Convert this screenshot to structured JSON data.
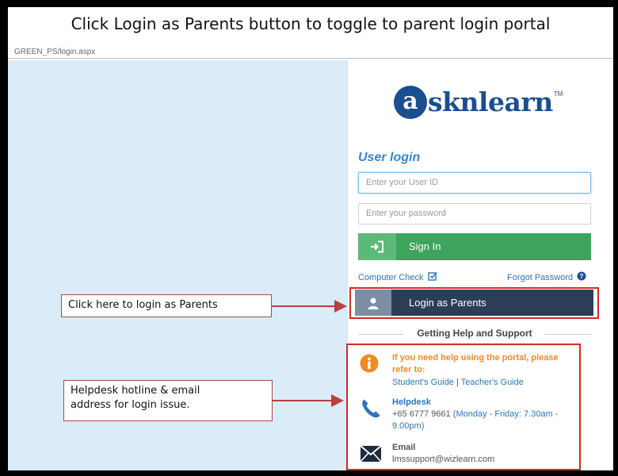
{
  "slide": {
    "title": "Click Login as Parents button to toggle to parent login portal"
  },
  "browser": {
    "url": "GREEN_PS/login.aspx"
  },
  "logo": {
    "letter": "a",
    "text": "sknlearn",
    "tm": "TM"
  },
  "login": {
    "heading": "User login",
    "user_id_placeholder": "Enter your User ID",
    "password_placeholder": "Enter your password",
    "signin_label": "Sign In",
    "computer_check": "Computer Check",
    "forgot_password": "Forgot Password",
    "parents_label": "Login as Parents"
  },
  "help": {
    "heading": "Getting Help and Support",
    "portal_help_line1": "If you need help using the portal, please",
    "portal_help_line2": "refer to:",
    "students_guide": "Student's Guide",
    "separator": "|",
    "teachers_guide": "Teacher's Guide",
    "helpdesk_title": "Helpdesk",
    "helpdesk_phone": "+65 6777 9661",
    "helpdesk_hours_part1": "(Monday - Friday: 7.30am -",
    "helpdesk_hours_part2": "9.00pm)",
    "email_title": "Email",
    "email_address": "lmssupport@wizlearn.com"
  },
  "callouts": {
    "parents": "Click here to login as Parents",
    "helpdesk_line1": "Helpdesk hotline & email",
    "helpdesk_line2": "address for login issue."
  },
  "colors": {
    "brand_blue": "#1b4e8f",
    "signin_green": "#3ca45c",
    "parents_navy": "#2c3e57",
    "help_orange": "#f08a24",
    "annotation_red": "#d12a2a"
  }
}
